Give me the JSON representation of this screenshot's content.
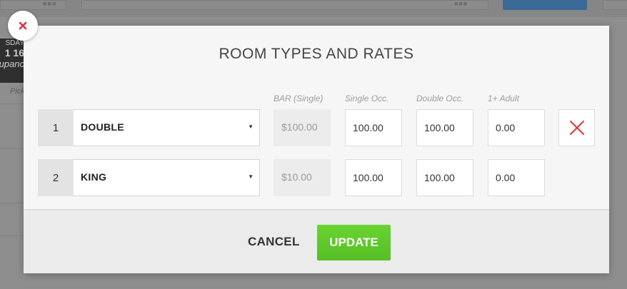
{
  "background": {
    "day_partial": "SDAY",
    "date_partial": "1 16",
    "word_partial": "upanc",
    "pick_partial": "Pick"
  },
  "modal": {
    "title": "ROOM TYPES AND RATES",
    "columns": {
      "bar": "BAR (Single)",
      "single": "Single Occ.",
      "double": "Double Occ.",
      "adult": "1+ Adult"
    },
    "rows": [
      {
        "num": "1",
        "room": "DOUBLE",
        "bar": "$100.00",
        "single": "100.00",
        "double": "100.00",
        "adult": "0.00"
      },
      {
        "num": "2",
        "room": "KING",
        "bar": "$10.00",
        "single": "100.00",
        "double": "100.00",
        "adult": "0.00"
      }
    ],
    "cancel_label": "CANCEL",
    "update_label": "UPDATE"
  },
  "colors": {
    "accent_green": "#5cc52a",
    "delete_red": "#e0343a",
    "close_red": "#d9343a"
  },
  "icons": {
    "close": "close-icon",
    "delete": "delete-row-icon",
    "dropdown": "chevron-down-icon"
  }
}
